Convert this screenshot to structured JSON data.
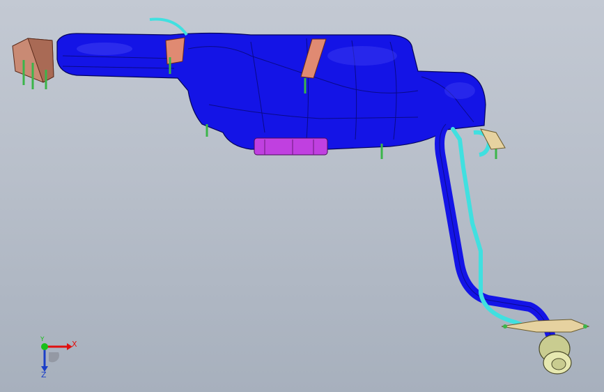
{
  "viewport": {
    "background_top": "#c3c9d3",
    "background_bottom": "#a7b0bd"
  },
  "model": {
    "tank_color": "#1414e6",
    "pipe_color": "#40e0e0",
    "bracket_color": "#c98a74",
    "pump_color": "#c040e0",
    "flange_color": "#e6d2a0",
    "cap_color": "#e6e8b0",
    "bolt_color": "#3bb54a"
  },
  "triad": {
    "x_label": "X",
    "y_label": "Y",
    "z_label": "Z",
    "x_color": "#e01010",
    "y_color": "#18c018",
    "z_color": "#1a3ec8"
  }
}
